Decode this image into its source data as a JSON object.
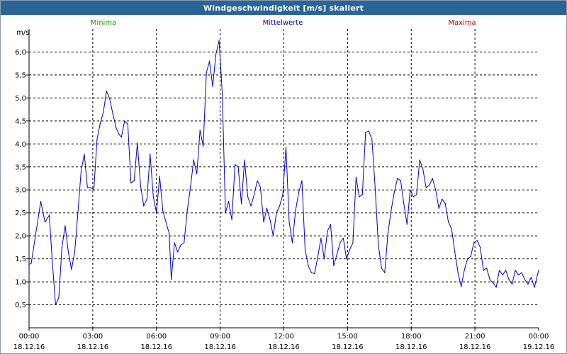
{
  "window": {
    "title": "Windgeschwindigkeit [m/s] skaliert"
  },
  "colors": {
    "title_bar": "#2a6496",
    "minima": "#00aa00",
    "mean": "#0000cc",
    "maxima": "#cc0000",
    "grid": "#000000"
  },
  "legend": [
    {
      "label": "Minima",
      "color": "#00aa00"
    },
    {
      "label": "Mittelwerte",
      "color": "#0000cc"
    },
    {
      "label": "Maxima",
      "color": "#cc0000"
    }
  ],
  "chart_data": {
    "type": "line",
    "title": "Windgeschwindigkeit [m/s] skaliert",
    "ylabel": "m/s",
    "xlabel": "",
    "xlim": [
      0,
      24
    ],
    "ylim": [
      0,
      6.5
    ],
    "grid": true,
    "legend_position": "top",
    "y_ticks": [
      {
        "value": 0.5,
        "label": "0,5"
      },
      {
        "value": 1.0,
        "label": "1,0"
      },
      {
        "value": 1.5,
        "label": "1,5"
      },
      {
        "value": 2.0,
        "label": "2,0"
      },
      {
        "value": 2.5,
        "label": "2,5"
      },
      {
        "value": 3.0,
        "label": "3,0"
      },
      {
        "value": 3.5,
        "label": "3,5"
      },
      {
        "value": 4.0,
        "label": "4,0"
      },
      {
        "value": 4.5,
        "label": "4,5"
      },
      {
        "value": 5.0,
        "label": "5,0"
      },
      {
        "value": 5.5,
        "label": "5,5"
      },
      {
        "value": 6.0,
        "label": "6,0"
      }
    ],
    "x_ticks": [
      {
        "value": 0,
        "time": "00:00",
        "date": "18.12.16"
      },
      {
        "value": 3,
        "time": "03:00",
        "date": "18.12.16"
      },
      {
        "value": 6,
        "time": "06:00",
        "date": "18.12.16"
      },
      {
        "value": 9,
        "time": "09:00",
        "date": "18.12.16"
      },
      {
        "value": 12,
        "time": "12:00",
        "date": "18.12.16"
      },
      {
        "value": 15,
        "time": "15:00",
        "date": "18.12.16"
      },
      {
        "value": 18,
        "time": "18:00",
        "date": "18.12.16"
      },
      {
        "value": 21,
        "time": "21:00",
        "date": "18.12.16"
      },
      {
        "value": 24,
        "time": "00:00",
        "date": "19.12.16"
      }
    ],
    "series": [
      {
        "name": "Mittelwerte",
        "color": "#0000cc",
        "points": [
          [
            0.0,
            1.38
          ],
          [
            0.1,
            1.4
          ],
          [
            0.4,
            2.3
          ],
          [
            0.55,
            2.75
          ],
          [
            0.75,
            2.3
          ],
          [
            0.95,
            2.45
          ],
          [
            1.1,
            1.4
          ],
          [
            1.25,
            0.5
          ],
          [
            1.4,
            0.65
          ],
          [
            1.55,
            1.75
          ],
          [
            1.7,
            2.22
          ],
          [
            1.85,
            1.65
          ],
          [
            2.0,
            1.27
          ],
          [
            2.15,
            1.65
          ],
          [
            2.3,
            2.5
          ],
          [
            2.45,
            3.4
          ],
          [
            2.6,
            3.78
          ],
          [
            2.75,
            3.05
          ],
          [
            2.9,
            3.05
          ],
          [
            3.05,
            3.0
          ],
          [
            3.2,
            4.1
          ],
          [
            3.35,
            4.45
          ],
          [
            3.5,
            4.7
          ],
          [
            3.65,
            5.15
          ],
          [
            3.8,
            4.98
          ],
          [
            3.95,
            4.65
          ],
          [
            4.1,
            4.35
          ],
          [
            4.25,
            4.2
          ],
          [
            4.35,
            4.15
          ],
          [
            4.5,
            4.5
          ],
          [
            4.65,
            4.43
          ],
          [
            4.8,
            3.15
          ],
          [
            4.95,
            3.2
          ],
          [
            5.1,
            4.02
          ],
          [
            5.25,
            3.1
          ],
          [
            5.4,
            2.65
          ],
          [
            5.55,
            2.8
          ],
          [
            5.7,
            3.78
          ],
          [
            5.85,
            2.85
          ],
          [
            6.0,
            2.5
          ],
          [
            6.15,
            3.3
          ],
          [
            6.3,
            2.55
          ],
          [
            6.45,
            2.3
          ],
          [
            6.6,
            2.05
          ],
          [
            6.7,
            1.05
          ],
          [
            6.85,
            1.85
          ],
          [
            7.0,
            1.65
          ],
          [
            7.15,
            1.8
          ],
          [
            7.3,
            1.85
          ],
          [
            7.45,
            2.55
          ],
          [
            7.6,
            3.05
          ],
          [
            7.75,
            3.65
          ],
          [
            7.9,
            3.35
          ],
          [
            8.05,
            4.3
          ],
          [
            8.2,
            3.95
          ],
          [
            8.35,
            5.55
          ],
          [
            8.5,
            5.8
          ],
          [
            8.65,
            5.25
          ],
          [
            8.8,
            5.95
          ],
          [
            8.95,
            6.25
          ],
          [
            9.1,
            5.1
          ],
          [
            9.25,
            2.5
          ],
          [
            9.4,
            2.75
          ],
          [
            9.55,
            2.35
          ],
          [
            9.7,
            3.55
          ],
          [
            9.85,
            3.5
          ],
          [
            10.0,
            2.7
          ],
          [
            10.15,
            3.65
          ],
          [
            10.3,
            2.85
          ],
          [
            10.45,
            2.65
          ],
          [
            10.6,
            2.9
          ],
          [
            10.75,
            3.2
          ],
          [
            10.9,
            3.05
          ],
          [
            11.05,
            2.3
          ],
          [
            11.2,
            2.6
          ],
          [
            11.35,
            2.35
          ],
          [
            11.5,
            2.0
          ],
          [
            11.65,
            2.5
          ],
          [
            11.8,
            2.65
          ],
          [
            11.95,
            2.9
          ],
          [
            12.1,
            3.93
          ],
          [
            12.25,
            2.3
          ],
          [
            12.4,
            1.85
          ],
          [
            12.55,
            2.55
          ],
          [
            12.7,
            2.95
          ],
          [
            12.85,
            3.2
          ],
          [
            13.0,
            1.7
          ],
          [
            13.15,
            1.35
          ],
          [
            13.3,
            1.2
          ],
          [
            13.45,
            1.18
          ],
          [
            13.6,
            1.55
          ],
          [
            13.75,
            1.95
          ],
          [
            13.9,
            1.5
          ],
          [
            14.05,
            2.1
          ],
          [
            14.2,
            2.25
          ],
          [
            14.35,
            1.35
          ],
          [
            14.5,
            1.6
          ],
          [
            14.65,
            1.85
          ],
          [
            14.8,
            1.95
          ],
          [
            14.95,
            1.5
          ],
          [
            15.1,
            1.7
          ],
          [
            15.25,
            1.85
          ],
          [
            15.4,
            3.28
          ],
          [
            15.55,
            2.85
          ],
          [
            15.7,
            2.9
          ],
          [
            15.85,
            4.25
          ],
          [
            16.0,
            4.28
          ],
          [
            16.15,
            4.1
          ],
          [
            16.3,
            3.05
          ],
          [
            16.45,
            1.8
          ],
          [
            16.6,
            1.3
          ],
          [
            16.75,
            1.2
          ],
          [
            16.9,
            2.05
          ],
          [
            17.05,
            2.55
          ],
          [
            17.2,
            2.95
          ],
          [
            17.35,
            3.25
          ],
          [
            17.5,
            3.2
          ],
          [
            17.65,
            2.7
          ],
          [
            17.8,
            2.25
          ],
          [
            17.95,
            3.0
          ],
          [
            18.1,
            2.85
          ],
          [
            18.25,
            2.9
          ],
          [
            18.4,
            3.65
          ],
          [
            18.55,
            3.45
          ],
          [
            18.7,
            3.05
          ],
          [
            18.85,
            3.1
          ],
          [
            19.0,
            3.25
          ],
          [
            19.15,
            3.0
          ],
          [
            19.3,
            2.6
          ],
          [
            19.45,
            2.8
          ],
          [
            19.6,
            2.7
          ],
          [
            19.75,
            2.3
          ],
          [
            19.9,
            2.15
          ],
          [
            20.05,
            1.65
          ],
          [
            20.2,
            1.2
          ],
          [
            20.35,
            0.9
          ],
          [
            20.5,
            1.25
          ],
          [
            20.65,
            1.5
          ],
          [
            20.8,
            1.55
          ],
          [
            20.95,
            1.85
          ],
          [
            21.1,
            1.9
          ],
          [
            21.25,
            1.75
          ],
          [
            21.4,
            1.25
          ],
          [
            21.55,
            1.3
          ],
          [
            21.7,
            1.05
          ],
          [
            21.85,
            0.98
          ],
          [
            22.0,
            0.88
          ],
          [
            22.15,
            1.25
          ],
          [
            22.3,
            1.15
          ],
          [
            22.45,
            1.25
          ],
          [
            22.6,
            1.05
          ],
          [
            22.75,
            0.95
          ],
          [
            22.9,
            1.25
          ],
          [
            23.05,
            1.15
          ],
          [
            23.2,
            1.2
          ],
          [
            23.35,
            1.05
          ],
          [
            23.5,
            0.95
          ],
          [
            23.65,
            1.1
          ],
          [
            23.8,
            0.88
          ],
          [
            24.0,
            1.25
          ]
        ]
      }
    ]
  }
}
